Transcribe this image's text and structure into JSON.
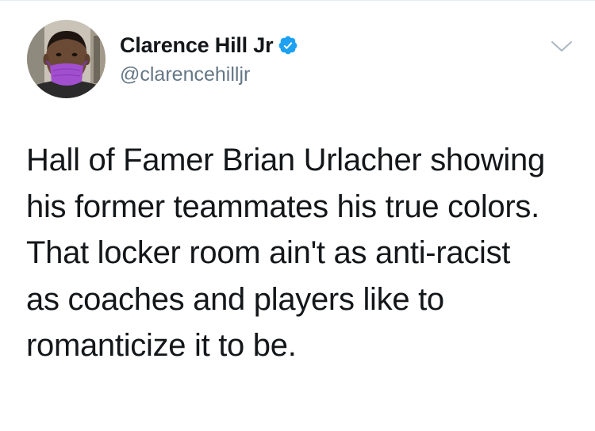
{
  "tweet": {
    "author": {
      "display_name": "Clarence Hill Jr",
      "handle": "@clarencehilljr",
      "verified": true,
      "avatar_icon": "profile-photo"
    },
    "menu_icon": "chevron-down-icon",
    "text_lines": [
      "Hall of Famer Brian Urlacher showing",
      "his former teammates his true colors.",
      "That locker room ain't as anti-racist",
      "as coaches and players like to",
      "romanticize it to be."
    ]
  },
  "colors": {
    "text": "#14171a",
    "secondary_text": "#657786",
    "verified_badge": "#1da1f2",
    "chevron": "#aab8c2"
  }
}
